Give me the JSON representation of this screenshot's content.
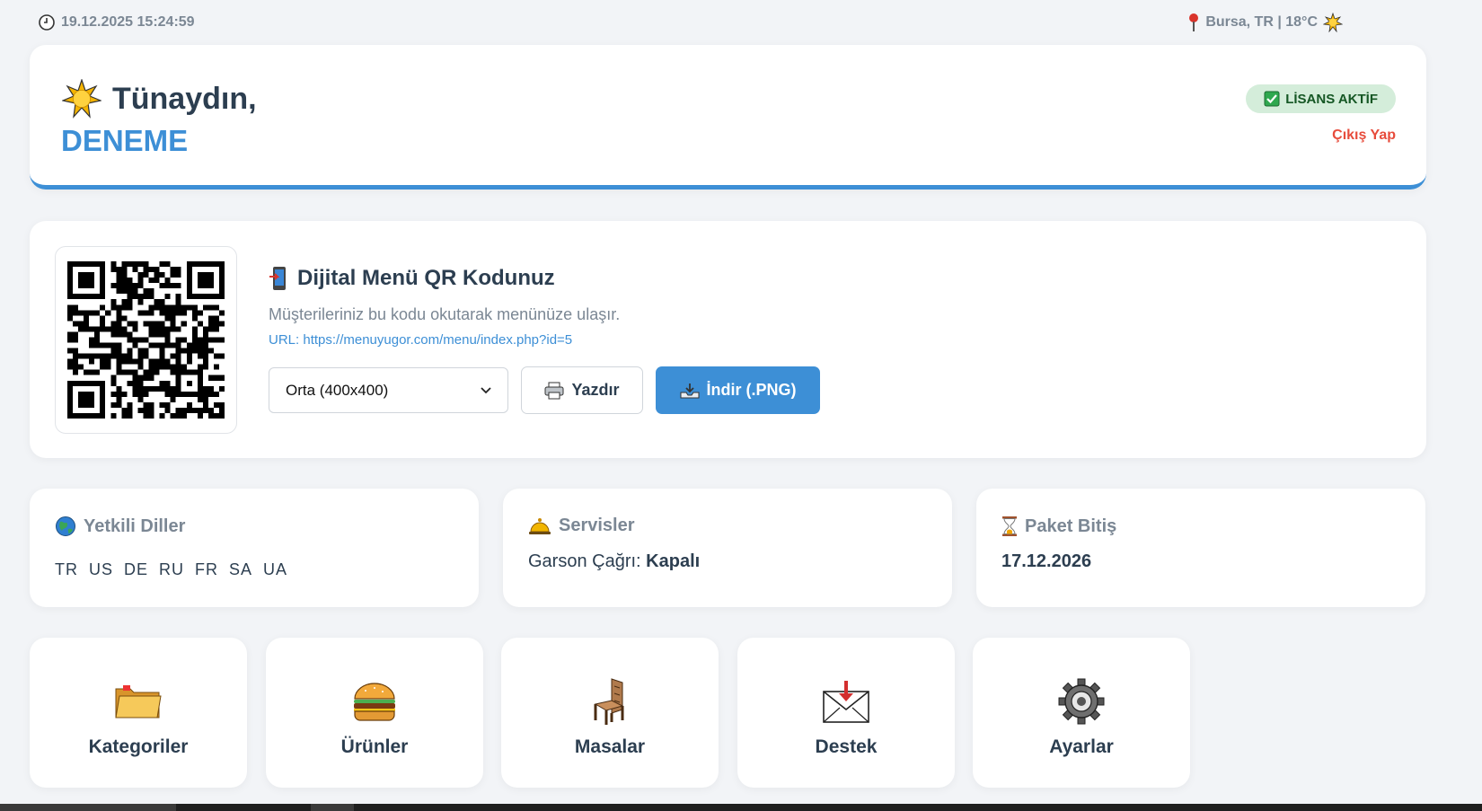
{
  "topbar": {
    "datetime": "19.12.2025 15:24:59",
    "location": "Bursa, TR | 18°C"
  },
  "header": {
    "greeting": "Tünaydın,",
    "username": "DENEME",
    "license_label": "LİSANS AKTİF",
    "logout_label": "Çıkış Yap"
  },
  "qr": {
    "title": "Dijital Menü QR Kodunuz",
    "description": "Müşterileriniz bu kodu okutarak menünüze ulaşır.",
    "url_prefix": "URL:",
    "url": "https://menuyugor.com/menu/index.php?id=5",
    "size_selected": "Orta (400x400)",
    "print_label": "Yazdır",
    "download_label": "İndir (.PNG)"
  },
  "info": {
    "languages": {
      "title": "Yetkili Diller",
      "codes": [
        "TR",
        "US",
        "DE",
        "RU",
        "FR",
        "SA",
        "UA"
      ]
    },
    "services": {
      "title": "Servisler",
      "waiter_label": "Garson Çağrı:",
      "waiter_value": "Kapalı"
    },
    "package": {
      "title": "Paket Bitiş",
      "date": "17.12.2026"
    }
  },
  "menu": [
    {
      "label": "Kategoriler",
      "icon": "folder-icon"
    },
    {
      "label": "Ürünler",
      "icon": "burger-icon"
    },
    {
      "label": "Masalar",
      "icon": "chair-icon"
    },
    {
      "label": "Destek",
      "icon": "inbox-envelope-icon"
    },
    {
      "label": "Ayarlar",
      "icon": "gear-icon"
    }
  ],
  "colors": {
    "accent": "#3d8fd6",
    "license_bg": "#d4edda",
    "license_text": "#155724",
    "logout": "#e74c3c",
    "muted": "#7b8794"
  }
}
